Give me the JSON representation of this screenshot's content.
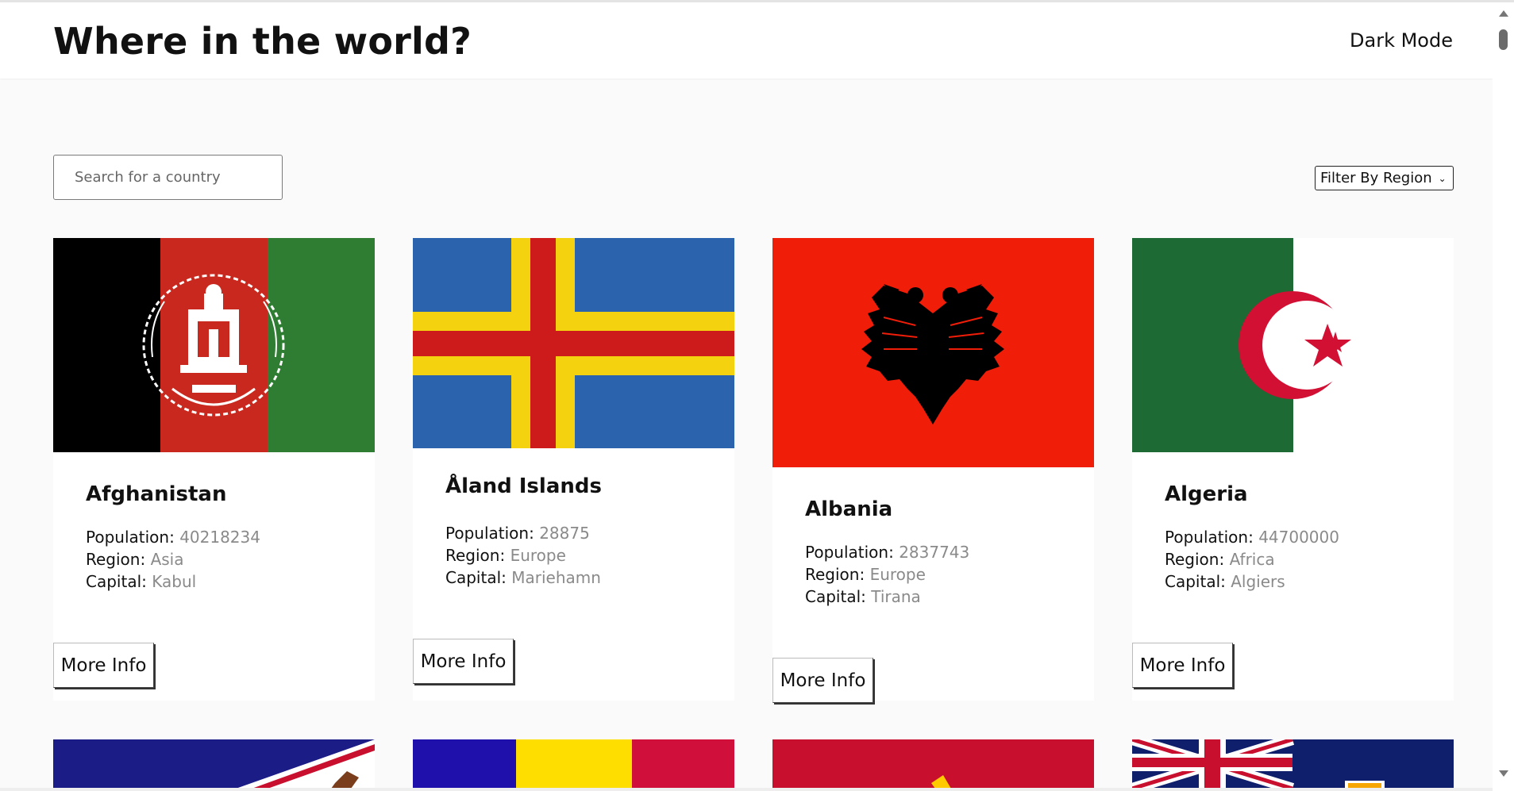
{
  "header": {
    "title": "Where in the world?",
    "dark_mode_label": "Dark Mode"
  },
  "search": {
    "placeholder": "Search for a country",
    "value": ""
  },
  "filter": {
    "label": "Filter By Region"
  },
  "labels": {
    "population": "Population:",
    "region": "Region:",
    "capital": "Capital:",
    "more_info": "More Info"
  },
  "countries": [
    {
      "name": "Afghanistan",
      "population": "40218234",
      "region": "Asia",
      "capital": "Kabul",
      "flag": "afghanistan-flag"
    },
    {
      "name": "Åland Islands",
      "population": "28875",
      "region": "Europe",
      "capital": "Mariehamn",
      "flag": "aland-islands-flag"
    },
    {
      "name": "Albania",
      "population": "2837743",
      "region": "Europe",
      "capital": "Tirana",
      "flag": "albania-flag"
    },
    {
      "name": "Algeria",
      "population": "44700000",
      "region": "Africa",
      "capital": "Algiers",
      "flag": "algeria-flag"
    }
  ],
  "partial_flags": [
    "american-samoa-flag",
    "andorra-flag",
    "angola-flag",
    "anguilla-flag"
  ],
  "colors": {
    "background": "#fafafa",
    "card": "#ffffff",
    "text": "#111111",
    "muted_value": "#8a8a8a"
  }
}
